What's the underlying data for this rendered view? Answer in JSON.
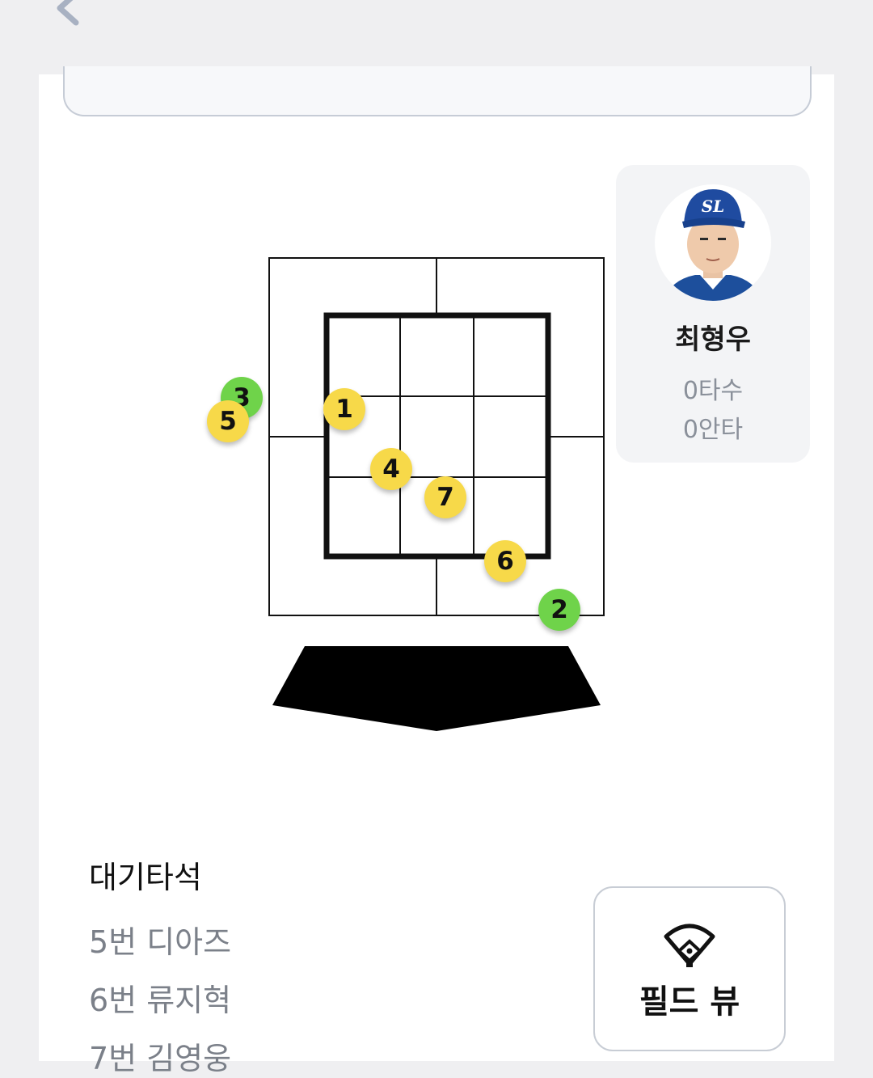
{
  "nav": {
    "back_icon": "chevron-left-icon"
  },
  "pitches": [
    {
      "number": "1",
      "result": "yellow"
    },
    {
      "number": "2",
      "result": "green"
    },
    {
      "number": "3",
      "result": "green"
    },
    {
      "number": "4",
      "result": "yellow"
    },
    {
      "number": "5",
      "result": "yellow"
    },
    {
      "number": "6",
      "result": "yellow"
    },
    {
      "number": "7",
      "result": "yellow"
    }
  ],
  "colors": {
    "yellow": "#f7d949",
    "green": "#6fd34a"
  },
  "batter": {
    "name": "최형우",
    "at_bats": "0타수",
    "hits": "0안타",
    "cap_logo": "SL"
  },
  "on_deck": {
    "title": "대기타석",
    "items": [
      "5번 디아즈",
      "6번 류지혁",
      "7번 김영웅"
    ]
  },
  "field_view": {
    "label": "필드 뷰",
    "icon": "baseball-field-icon"
  }
}
